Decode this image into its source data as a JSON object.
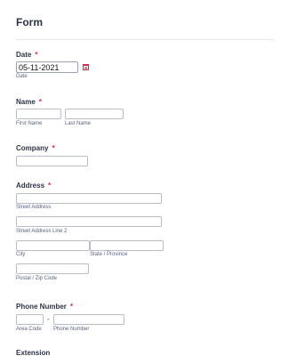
{
  "form": {
    "title": "Form"
  },
  "date": {
    "label": "Date",
    "required_mark": "*",
    "value": "05-11-2021",
    "sublabel": "Date",
    "icon": "calendar-icon"
  },
  "name": {
    "label": "Name",
    "required_mark": "*",
    "first_sublabel": "First Name",
    "last_sublabel": "Last Name"
  },
  "company": {
    "label": "Company",
    "required_mark": "*"
  },
  "address": {
    "label": "Address",
    "required_mark": "*",
    "street_sublabel": "Street Address",
    "street2_sublabel": "Street Address Line 2",
    "city_sublabel": "City",
    "state_sublabel": "State / Province",
    "postal_sublabel": "Postal / Zip Code"
  },
  "phone": {
    "label": "Phone Number",
    "required_mark": "*",
    "separator": "-",
    "area_sublabel": "Area Code",
    "number_sublabel": "Phone Number"
  },
  "extension": {
    "label": "Extension"
  },
  "colors": {
    "required": "#e0254f",
    "calendar_icon": "#e0254f",
    "input_border": "#b8bdc9",
    "text": "#2c3345",
    "sublabel": "#57647e"
  }
}
